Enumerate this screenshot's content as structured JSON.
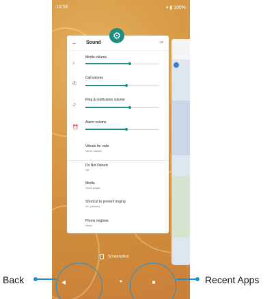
{
  "status_bar": {
    "time": "10:56",
    "battery": "100%"
  },
  "app": {
    "title": "Sound",
    "settings": [
      {
        "title": "Media volume",
        "slider": 0.6
      },
      {
        "title": "Call volume",
        "slider": 0.56
      },
      {
        "title": "Ring & notification volume",
        "slider": 0.6
      },
      {
        "title": "Alarm volume",
        "slider": 0.56
      },
      {
        "title": "Vibrate for calls",
        "subtitle": "Never vibrate"
      },
      {
        "title": "Do Not Disturb",
        "subtitle": "Off"
      },
      {
        "title": "Media",
        "subtitle": "Show player"
      },
      {
        "title": "Shortcut to prevent ringing",
        "subtitle": "On (vibrate)"
      },
      {
        "title": "Phone ringtone",
        "subtitle": "None"
      }
    ]
  },
  "screenshot_label": "Screenshot",
  "callouts": {
    "back": "Back",
    "recent_apps": "Recent Apps"
  },
  "colors": {
    "accent": "#1a8f7f",
    "callout": "#1f8ed6",
    "wallpaper": "#d89a45"
  }
}
